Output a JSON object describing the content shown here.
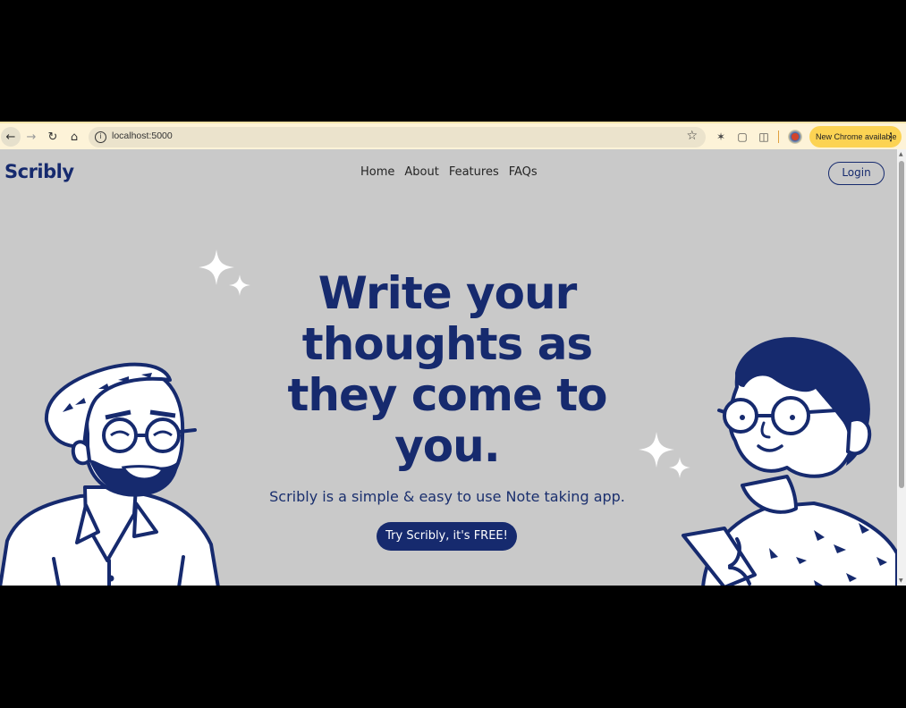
{
  "browser": {
    "url": "localhost:5000",
    "update_chip_label": "New Chrome available",
    "icons": [
      "back-arrow-icon",
      "forward-arrow-icon",
      "reload-icon",
      "home-icon",
      "site-info-icon",
      "star-icon",
      "bug-icon",
      "extension-puzzle-icon",
      "profile-avatar",
      "kebab-menu-icon"
    ]
  },
  "site": {
    "brand": "Scribly",
    "nav": [
      "Home",
      "About",
      "Features",
      "FAQs"
    ],
    "login_label": "Login",
    "headline": "Write your thoughts as they come to you.",
    "subtitle": "Scribly is a simple & easy to use Note taking app.",
    "cta_label": "Try Scribly, it's FREE!"
  },
  "colors": {
    "brand_navy": "#162a6e",
    "page_background": "#c9c9c9",
    "update_chip": "#fcd353"
  }
}
